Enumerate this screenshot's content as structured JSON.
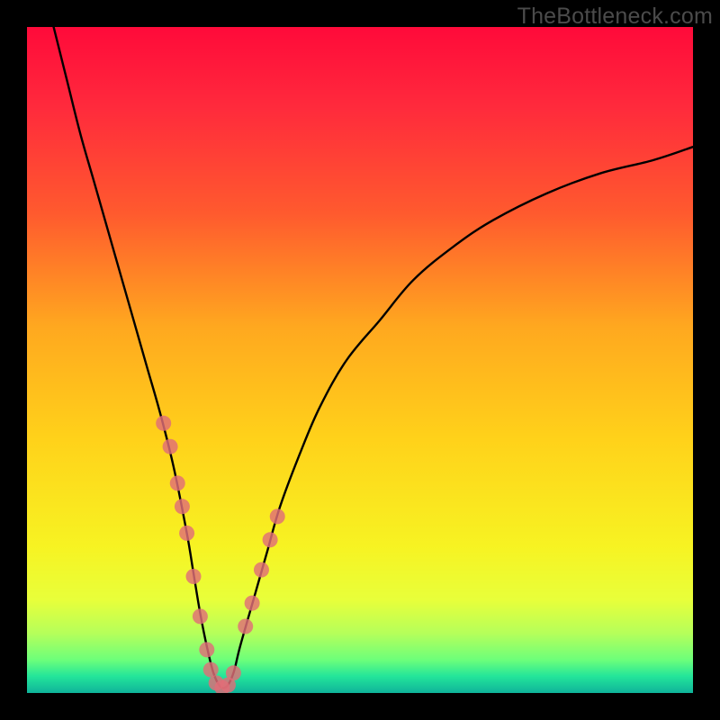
{
  "watermark": "TheBottleneck.com",
  "colors": {
    "frame": "#000000",
    "curve": "#000000",
    "marker": "#e06e78",
    "gradient_stops": [
      {
        "offset": 0.0,
        "color": "#ff0a3a"
      },
      {
        "offset": 0.12,
        "color": "#ff2a3c"
      },
      {
        "offset": 0.28,
        "color": "#ff5a2e"
      },
      {
        "offset": 0.45,
        "color": "#ffa81f"
      },
      {
        "offset": 0.62,
        "color": "#ffd21a"
      },
      {
        "offset": 0.78,
        "color": "#f7f322"
      },
      {
        "offset": 0.86,
        "color": "#e8ff3a"
      },
      {
        "offset": 0.91,
        "color": "#b6ff5a"
      },
      {
        "offset": 0.95,
        "color": "#6dff7a"
      },
      {
        "offset": 0.975,
        "color": "#23e59a"
      },
      {
        "offset": 1.0,
        "color": "#0fb39a"
      }
    ]
  },
  "chart_data": {
    "type": "line",
    "title": "",
    "xlabel": "",
    "ylabel": "",
    "xlim": [
      0,
      100
    ],
    "ylim": [
      0,
      100
    ],
    "curve": {
      "x": [
        4,
        6,
        8,
        10,
        12,
        14,
        16,
        18,
        20,
        22,
        24,
        25,
        26,
        27,
        28,
        29,
        30,
        31,
        32,
        34,
        36,
        38,
        41,
        44,
        48,
        53,
        58,
        64,
        70,
        78,
        86,
        94,
        100
      ],
      "y": [
        100,
        92,
        84,
        77,
        70,
        63,
        56,
        49,
        42,
        34,
        24,
        18,
        12,
        7,
        3,
        1,
        1,
        3,
        7,
        14,
        21,
        28,
        36,
        43,
        50,
        56,
        62,
        67,
        71,
        75,
        78,
        80,
        82
      ]
    },
    "series": [
      {
        "name": "markers",
        "x": [
          20.5,
          21.5,
          22.6,
          23.3,
          24.0,
          25.0,
          26.0,
          27.0,
          27.6,
          28.4,
          29.3,
          30.2,
          31.0,
          32.8,
          33.8,
          35.2,
          36.5,
          37.6
        ],
        "y": [
          40.5,
          37.0,
          31.5,
          28.0,
          24.0,
          17.5,
          11.5,
          6.5,
          3.5,
          1.5,
          0.8,
          1.2,
          3.0,
          10.0,
          13.5,
          18.5,
          23.0,
          26.5
        ]
      }
    ]
  }
}
